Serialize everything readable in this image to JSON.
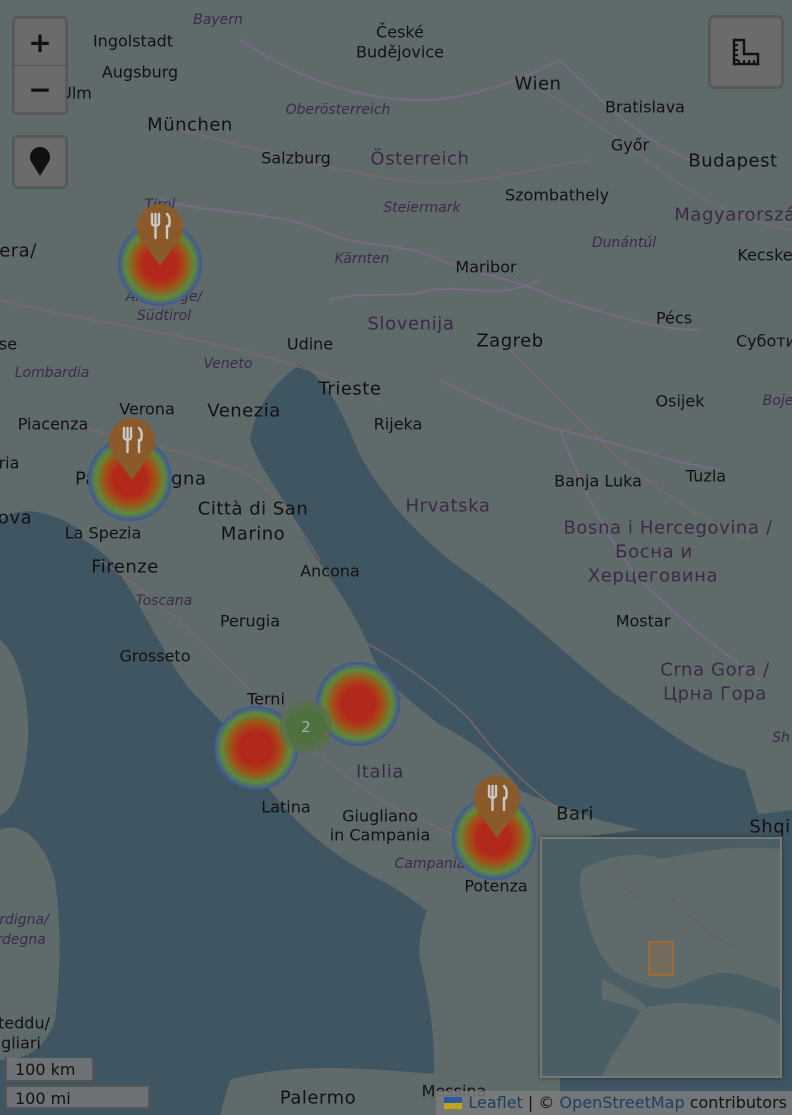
{
  "labels": {
    "bayern": "Bayern",
    "ceske_budejovice_1": "České",
    "ceske_budejovice_2": "Budějovice",
    "ingolstadt": "Ingolstadt",
    "augsburg": "Augsburg",
    "ulm": "Ulm",
    "munchen": "München",
    "wien": "Wien",
    "bratislava": "Bratislava",
    "oberosterreich": "Oberösterreich",
    "gyor": "Győr",
    "salzburg": "Salzburg",
    "osterreich": "Österreich",
    "budapest": "Budapest",
    "szombathely": "Szombathely",
    "steiermark": "Steiermark",
    "magyarorszag": "Magyarorszá",
    "tirol": "Tirol",
    "era": "era/",
    "dunantul": "Dunántúl",
    "kecske": "Kecske",
    "karnten": "Kärnten",
    "maribor": "Maribor",
    "alto_adige_1": "Alto Adige/",
    "alto_adige_2": "Südtirol",
    "pecs": "Pécs",
    "slovenija": "Slovenija",
    "se": "se",
    "zagreb": "Zagreb",
    "subot": "Суботи",
    "udine": "Udine",
    "lombardia": "Lombardia",
    "veneto": "Veneto",
    "trieste": "Trieste",
    "osijek": "Osijek",
    "boje": "Boje",
    "verona": "Verona",
    "venezia": "Venezia",
    "rijeka": "Rijeka",
    "piacenza": "Piacenza",
    "ria": "ria",
    "parma": "Pa",
    "bologna": "ogna",
    "banja_luka": "Banja Luka",
    "tuzla": "Tuzla",
    "hrvatska": "Hrvatska",
    "ova": "ova",
    "citta_1": "Città di San",
    "citta_2": "Marino",
    "la_spezia": "La Spezia",
    "bih_1": "Bosna i Hercegovina /",
    "bih_2": "Босна и",
    "bih_3": "Херцеговина",
    "firenze": "Firenze",
    "ancona": "Ancona",
    "toscana": "Toscana",
    "perugia": "Perugia",
    "mostar": "Mostar",
    "grosseto": "Grosseto",
    "crna_gora_1": "Crna Gora /",
    "crna_gora_2": "Црна Гора",
    "terni": "Terni",
    "sh": "Sh",
    "italia": "Italia",
    "bari": "Bari",
    "latina": "Latina",
    "giugliano_1": "Giugliano",
    "giugliano_2": "in Campania",
    "shqi": "Shqi",
    "campania": "Campania",
    "potenza": "Potenza",
    "sardegna_1": "rdigna/",
    "sardegna_2": "rdegna",
    "sardegna_3": "teddu/",
    "sardegna_4": "gliari",
    "palermo": "Palermo",
    "messina": "Messina"
  },
  "controls": {
    "zoom_in": "+",
    "zoom_out": "−"
  },
  "cluster_count": "2",
  "scale": {
    "metric": "100 km",
    "imperial": "100 mi"
  },
  "attribution": {
    "leaflet": "Leaflet",
    "separator": " | © ",
    "osm": "OpenStreetMap",
    "suffix": " contributors"
  },
  "markers": [
    {
      "name": "restaurant-marker-alto-adige",
      "icon": "fork-knife-icon"
    },
    {
      "name": "restaurant-marker-parma",
      "icon": "fork-knife-icon"
    },
    {
      "name": "restaurant-marker-foggia",
      "icon": "fork-knife-icon"
    }
  ],
  "colors": {
    "marker": "#8a5a2a",
    "land": "#5f6a6b",
    "sea": "#3f5561",
    "border": "#7a6b82"
  }
}
